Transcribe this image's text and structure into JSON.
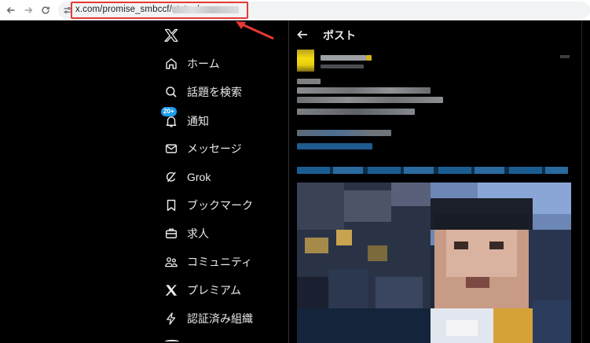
{
  "browser": {
    "url": "x.com/promise_smbccf/status/"
  },
  "nav": {
    "items": [
      {
        "label": "ホーム",
        "icon": "home-icon"
      },
      {
        "label": "話題を検索",
        "icon": "search-icon"
      },
      {
        "label": "通知",
        "icon": "bell-icon",
        "badge": "20+"
      },
      {
        "label": "メッセージ",
        "icon": "mail-icon"
      },
      {
        "label": "Grok",
        "icon": "grok-icon"
      },
      {
        "label": "ブックマーク",
        "icon": "bookmark-icon"
      },
      {
        "label": "求人",
        "icon": "briefcase-icon"
      },
      {
        "label": "コミュニティ",
        "icon": "community-icon"
      },
      {
        "label": "プレミアム",
        "icon": "x-premium-icon"
      },
      {
        "label": "認証済み組織",
        "icon": "lightning-icon"
      }
    ]
  },
  "post": {
    "header_title": "ポスト"
  },
  "colors": {
    "accent": "#1d9bf0",
    "annotation": "#e53935",
    "avatar": "#f5dd12"
  }
}
